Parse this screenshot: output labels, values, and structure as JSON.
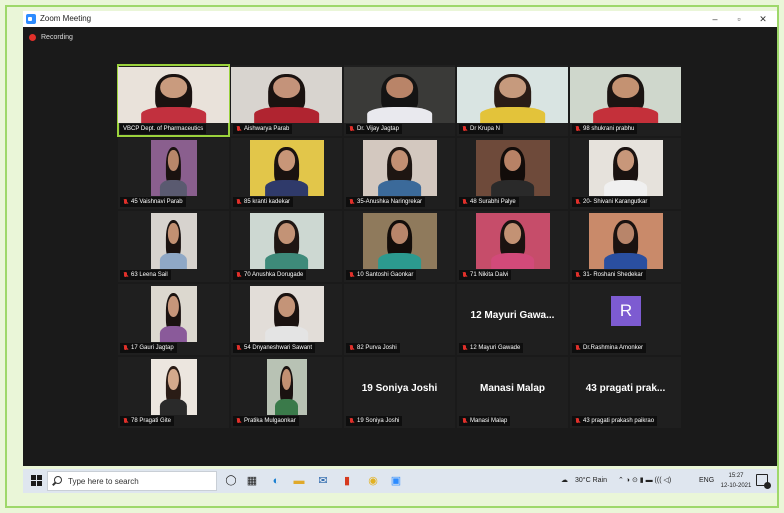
{
  "window": {
    "title": "Zoom Meeting",
    "minimize": "–",
    "maximize": "▫",
    "close": "✕"
  },
  "recording": {
    "label": "Recording"
  },
  "participants": [
    {
      "name": "VBCP Dept. of Pharmaceutics",
      "muted": false,
      "video": true,
      "active": true,
      "bg": "#e9e2da",
      "hair": "#1a1210",
      "skin": "#c99b7e",
      "shirt": "#c2303e"
    },
    {
      "name": "Aishwarya Parab",
      "muted": true,
      "video": true,
      "bg": "#d8d4cf",
      "hair": "#1a1210",
      "skin": "#c4937a",
      "shirt": "#b02430"
    },
    {
      "name": "Dr. Vijay Jagtap",
      "muted": true,
      "video": true,
      "bg": "#3a3a38",
      "hair": "#141414",
      "skin": "#b98468",
      "shirt": "#e9e9ee"
    },
    {
      "name": "Dr Krupa N",
      "muted": true,
      "video": true,
      "bg": "#d9e4e2",
      "hair": "#2a1c16",
      "skin": "#c69a7d",
      "shirt": "#e3c33a"
    },
    {
      "name": "98 shukrani prabhu",
      "muted": true,
      "video": true,
      "bg": "#cfd7cc",
      "hair": "#1b1412",
      "skin": "#c49272",
      "shirt": "#c4303a"
    },
    {
      "name": "45 Vaishnavi Parab",
      "muted": true,
      "video": true,
      "bg": "#8a5f8e",
      "hair": "#1a1210",
      "skin": "#b9876a",
      "shirt": "#5a5a70"
    },
    {
      "name": "85  kranti kadekar",
      "muted": true,
      "video": true,
      "bg": "#e2c64a",
      "hair": "#1a1210",
      "skin": "#c89678",
      "shirt": "#2f3a6a"
    },
    {
      "name": "35-Anushka Naringrekar",
      "muted": true,
      "video": true,
      "bg": "#d3c8bf",
      "hair": "#1e1612",
      "skin": "#c39073",
      "shirt": "#3b6a9a"
    },
    {
      "name": "48 Surabhi Palye",
      "muted": true,
      "video": true,
      "bg": "#6e4a3a",
      "hair": "#120c0a",
      "skin": "#b88266",
      "shirt": "#2a2a2a"
    },
    {
      "name": "20- Shivani Karangutkar",
      "muted": true,
      "video": true,
      "bg": "#e6e2dc",
      "hair": "#1a1210",
      "skin": "#c8977a",
      "shirt": "#f0f0f0"
    },
    {
      "name": "63 Leena Sail",
      "muted": true,
      "video": true,
      "bg": "#d7d3ce",
      "hair": "#1a1210",
      "skin": "#c29072",
      "shirt": "#8fa8c6"
    },
    {
      "name": "70 Anushka Dorugade",
      "muted": true,
      "video": true,
      "bg": "#cdd8d2",
      "hair": "#1f1613",
      "skin": "#c39376",
      "shirt": "#3e8a7a"
    },
    {
      "name": "10 Santoshi Gaonkar",
      "muted": true,
      "video": true,
      "bg": "#8f7a5c",
      "hair": "#130d0a",
      "skin": "#b8856a",
      "shirt": "#2c9a8f"
    },
    {
      "name": "71 Nikita Dalvi",
      "muted": true,
      "video": true,
      "bg": "#c64d6a",
      "hair": "#1a1210",
      "skin": "#c39274",
      "shirt": "#d24a7a"
    },
    {
      "name": "31- Roshani Shedekar",
      "muted": true,
      "video": true,
      "bg": "#c98a6a",
      "hair": "#1a1210",
      "skin": "#b8856a",
      "shirt": "#2a4fa0"
    },
    {
      "name": "17 Gauri Jagtap",
      "muted": true,
      "video": true,
      "bg": "#dcd8cf",
      "hair": "#1a1210",
      "skin": "#c7967a",
      "shirt": "#8a5a9a"
    },
    {
      "name": "54 Dnyaneshwari Sawant",
      "muted": true,
      "video": true,
      "bg": "#e2ddd8",
      "hair": "#1a1210",
      "skin": "#c49478",
      "shirt": "#e4e4e4"
    },
    {
      "name": "82 Purva Joshi",
      "muted": true,
      "video": false
    },
    {
      "name": "12 Mayuri Gawade",
      "muted": true,
      "video": false,
      "display": "12 Mayuri Gawa..."
    },
    {
      "name": "Dr.Rashmina Amonker",
      "muted": true,
      "video": false,
      "avatar": "R"
    },
    {
      "name": "78 Pragati Gite",
      "muted": true,
      "video": true,
      "bg": "#ece6df",
      "hair": "#2a1c16",
      "skin": "#d4a98c",
      "shirt": "#2a2a2a"
    },
    {
      "name": "Pratika Mulgaonkar",
      "muted": true,
      "video": true,
      "bg": "#b8c2b4",
      "hair": "#1a1210",
      "skin": "#c29072",
      "shirt": "#3a7a4a"
    },
    {
      "name": "19 Soniya Joshi",
      "muted": true,
      "video": false,
      "display": "19 Soniya Joshi"
    },
    {
      "name": "Manasi Malap",
      "muted": true,
      "video": false,
      "display": "Manasi Malap"
    },
    {
      "name": "43 pragati prakash paikrao",
      "muted": true,
      "video": false,
      "display": "43 pragati prak..."
    }
  ],
  "taskbar": {
    "search_placeholder": "Type here to search",
    "weather": "30°C  Rain",
    "tray_glyphs": "⌃ ◑ ⊙ ▮ ▬ ((( ◁)",
    "language": "ENG",
    "time": "15:27",
    "date": "12-10-2021",
    "apps": [
      "task-view",
      "widgets",
      "edge",
      "file-explorer",
      "mail",
      "office",
      "chrome",
      "zoom"
    ]
  }
}
